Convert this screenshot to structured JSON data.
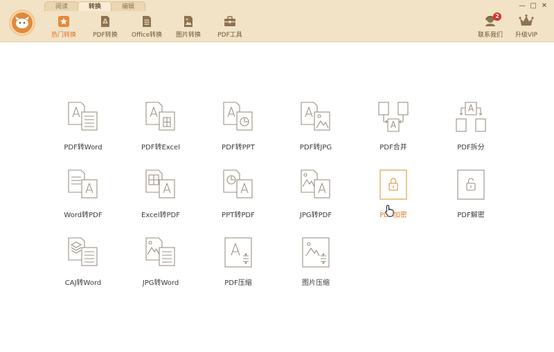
{
  "header": {
    "mode_tabs": [
      "阅读",
      "转换",
      "编辑"
    ],
    "toolbar": [
      {
        "label": "热门转换",
        "icon": "star-icon"
      },
      {
        "label": "PDF转换",
        "icon": "pdf-icon"
      },
      {
        "label": "Office转换",
        "icon": "office-doc-icon"
      },
      {
        "label": "图片转换",
        "icon": "image-icon"
      },
      {
        "label": "PDF工具",
        "icon": "toolbox-icon"
      }
    ],
    "contact": {
      "label": "联系我们",
      "badge": "2"
    },
    "vip": {
      "label": "升级VIP"
    },
    "window_controls": [
      "—",
      "□",
      "✕"
    ]
  },
  "tools": [
    {
      "label": "PDF转Word"
    },
    {
      "label": "PDF转Excel"
    },
    {
      "label": "PDF转PPT"
    },
    {
      "label": "PDF转JPG"
    },
    {
      "label": "PDF合并"
    },
    {
      "label": "PDF拆分"
    },
    {
      "label": "Word转PDF"
    },
    {
      "label": "Excel转PDF"
    },
    {
      "label": "PPT转PDF"
    },
    {
      "label": "JPG转PDF"
    },
    {
      "label": "PDF加密"
    },
    {
      "label": "PDF解密"
    },
    {
      "label": "CAJ转Word"
    },
    {
      "label": "JPG转Word"
    },
    {
      "label": "PDF压缩"
    },
    {
      "label": "图片压缩"
    }
  ],
  "colors": {
    "accent": "#e0732a",
    "header_bg": "#f3e3c6",
    "icon_stroke": "#9a8f82"
  }
}
